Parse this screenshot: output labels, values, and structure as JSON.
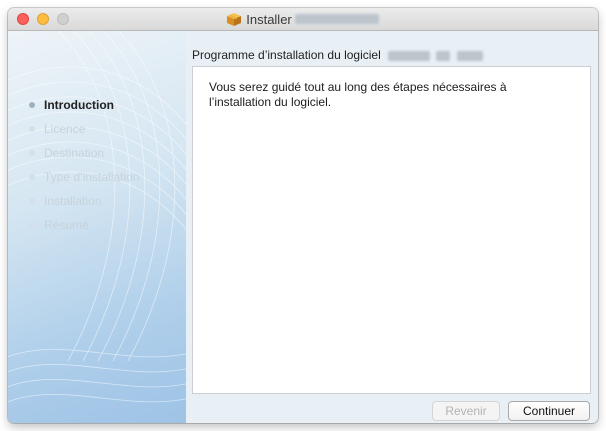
{
  "window": {
    "title": "Installer",
    "controls": [
      "close",
      "minimize",
      "maximize"
    ]
  },
  "sidebar": {
    "steps": [
      {
        "label": "Introduction",
        "state": "active"
      },
      {
        "label": "Licence",
        "state": "inactive"
      },
      {
        "label": "Destination",
        "state": "inactive"
      },
      {
        "label": "Type d’installation",
        "state": "inactive"
      },
      {
        "label": "Installation",
        "state": "inactive"
      },
      {
        "label": "Résumé",
        "state": "inactive"
      }
    ]
  },
  "content": {
    "header": "Programme d’installation du logiciel",
    "body": "Vous serez guidé tout au long des étapes nécessaires à l’installation du logiciel."
  },
  "buttons": {
    "back_label": "Revenir",
    "back_enabled": false,
    "continue_label": "Continuer"
  },
  "colors": {
    "close": "#fc605b",
    "minimize": "#fdbc40",
    "sidebar_blue": "#9ec3e6",
    "inactive_text": "#c7d3dc"
  }
}
